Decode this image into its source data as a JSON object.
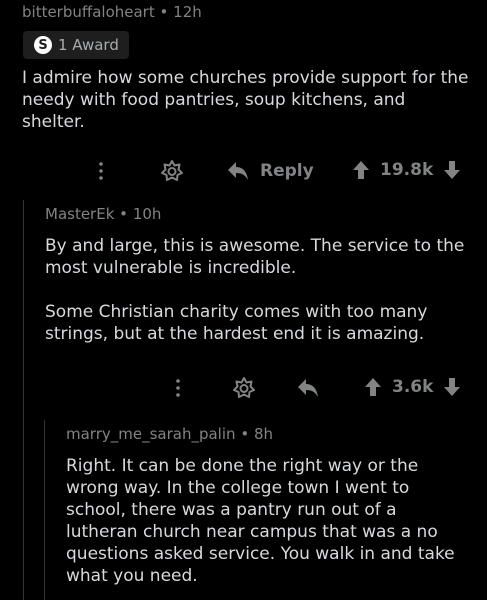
{
  "comments": [
    {
      "author": "bitterbuffaloheart",
      "separator": "•",
      "time": "12h",
      "award_icon_letter": "S",
      "award_label": "1 Award",
      "paragraphs": [
        "I admire how some churches provide support for the needy with food pantries, soup kitchens, and shelter."
      ],
      "reply_label": "Reply",
      "score": "19.8k"
    },
    {
      "author": "MasterEk",
      "separator": "•",
      "time": "10h",
      "paragraphs": [
        "By and large, this is awesome. The service to the most vulnerable is incredible.",
        "Some Christian charity comes with too many strings, but at the hardest end it is amazing."
      ],
      "score": "3.6k"
    },
    {
      "author": "marry_me_sarah_palin",
      "separator": "•",
      "time": "8h",
      "paragraphs": [
        "Right. It can be done the right way or the wrong way. In the college town I went to school, there was a pantry run out of a lutheran church near campus that was a no questions asked service. You walk in and take what you need."
      ]
    }
  ],
  "icons": {
    "more": "more-dots-icon",
    "award": "award-flower-icon",
    "reply": "reply-arrow-icon",
    "upvote": "upvote-arrow-icon",
    "downvote": "downvote-arrow-icon"
  },
  "colors": {
    "background": "#000000",
    "text": "#d7dadc",
    "muted": "#818384",
    "thread_line": "#343536"
  }
}
